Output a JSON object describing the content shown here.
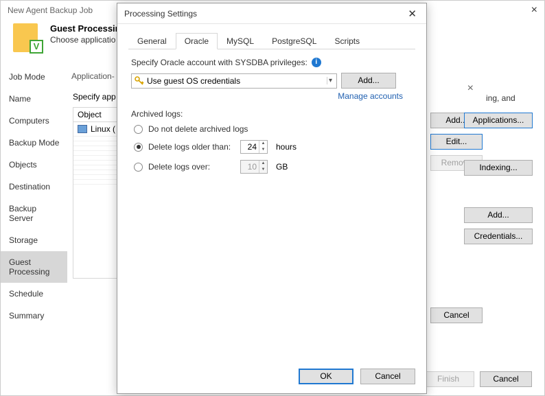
{
  "wizard": {
    "title": "New Agent Backup Job",
    "header_title": "Guest Processing",
    "header_desc": "Choose applicatio",
    "nav": [
      "Job Mode",
      "Name",
      "Computers",
      "Backup Mode",
      "Objects",
      "Destination",
      "Backup Server",
      "Storage",
      "Guest Processing",
      "Schedule",
      "Summary"
    ],
    "active_nav": "Guest Processing",
    "footer": {
      "finish": "Finish",
      "cancel": "Cancel"
    },
    "frag_text": "ing, and"
  },
  "secondary": {
    "tabrow": "Application-",
    "specify": "Specify app",
    "col_header": "Object",
    "row1": "Linux (",
    "buttons": {
      "add": "Add...",
      "edit": "Edit...",
      "remove": "Remove",
      "cancel": "Cancel"
    }
  },
  "right_col": {
    "applications": "Applications...",
    "indexing": "Indexing...",
    "add": "Add...",
    "credentials": "Credentials..."
  },
  "dialog": {
    "title": "Processing Settings",
    "tabs": [
      "General",
      "Oracle",
      "MySQL",
      "PostgreSQL",
      "Scripts"
    ],
    "active_tab": "Oracle",
    "account_label": "Specify Oracle account with SYSDBA privileges:",
    "combo_text": "Use guest OS credentials",
    "add_btn": "Add...",
    "manage_link": "Manage accounts",
    "archived_label": "Archived logs:",
    "radios": {
      "no_delete": "Do not delete archived logs",
      "older": "Delete logs older than:",
      "over": "Delete logs over:"
    },
    "older_val": "24",
    "older_unit": "hours",
    "over_val": "10",
    "over_unit": "GB",
    "ok": "OK",
    "cancel": "Cancel"
  },
  "chart_data": null
}
